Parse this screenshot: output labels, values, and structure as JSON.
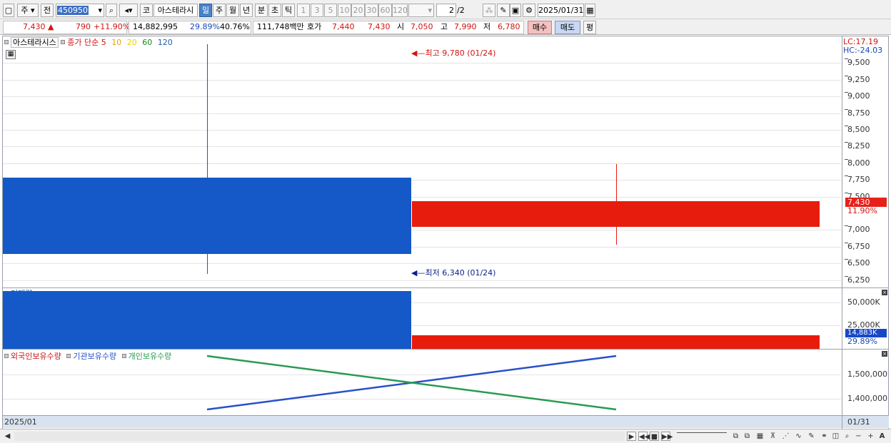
{
  "toolbar": {
    "interval_label": "주",
    "prev_label": "전",
    "code": "450950",
    "market_label": "코",
    "stock_name": "아스테라시",
    "periods": [
      "일",
      "주",
      "월",
      "년",
      "분",
      "초",
      "틱"
    ],
    "active_period": "일",
    "ticks": [
      "1",
      "3",
      "5",
      "10",
      "20",
      "30",
      "60",
      "120"
    ],
    "page_current": "2",
    "page_total": "/2",
    "date": "2025/01/31"
  },
  "quote": {
    "price": "7,430",
    "change": "790",
    "change_pct": "+11.90%",
    "volume": "14,882,995",
    "turnover": "29.89%",
    "ratio": "40.76%",
    "amount": "111,748백만",
    "hoga_label": "호가",
    "hoga_ask": "7,440",
    "hoga_bid": "7,430",
    "open_label": "시",
    "open": "7,050",
    "high_label": "고",
    "high": "7,990",
    "low_label": "저",
    "low": "6,780",
    "buy_label": "매수",
    "sell_label": "매도",
    "eval_label": "평"
  },
  "price_panel": {
    "name_tag": "아스테라시스",
    "legend_title": "종가 단순",
    "ma_labels": [
      "5",
      "10",
      "20",
      "60",
      "120"
    ],
    "ma_colors": [
      "#c81414",
      "#e8a000",
      "#e8d000",
      "#1a8a1a",
      "#1a60b0"
    ],
    "lc": "LC:17.19",
    "hc": "HC:-24.03",
    "max_label": "최고 9,780 (01/24)",
    "min_label": "최저 6,340 (01/24)",
    "current_price_tag": "7,430",
    "current_pct_tag": "11.90%"
  },
  "volume_panel": {
    "title": "거래량",
    "current_tag": "14,883K",
    "turnover_tag": "29.89%"
  },
  "holding_panel": {
    "series_labels": [
      "외국인보유수량",
      "기관보유수량",
      "개인보유수량"
    ],
    "series_colors": [
      "#c81414",
      "#2850c8",
      "#2a9a50"
    ]
  },
  "x_axis": {
    "start_label": "2025/01",
    "end_label": "01/31"
  },
  "chart_data": [
    {
      "type": "candlestick",
      "categories": [
        "01/24",
        "01/31"
      ],
      "series": [
        {
          "open": [
            7780,
            7050
          ],
          "high": [
            9780,
            7990
          ],
          "low": [
            6340,
            6780
          ],
          "close": [
            6640,
            7430
          ]
        }
      ],
      "y_ticks": [
        "9,500",
        "9,250",
        "9,000",
        "8,750",
        "8,500",
        "8,250",
        "8,000",
        "7,750",
        "7,500",
        "7,000",
        "6,750",
        "6,500",
        "6,250"
      ],
      "ylim": [
        6150,
        9900
      ],
      "grid": true
    },
    {
      "type": "bar",
      "title": "거래량",
      "categories": [
        "01/24",
        "01/31"
      ],
      "values": [
        62000,
        14883
      ],
      "colors": [
        "#1558c8",
        "#e81c0c"
      ],
      "y_ticks": [
        "50,000K",
        "25,000K"
      ],
      "ylim": [
        0,
        65000
      ]
    },
    {
      "type": "line",
      "categories": [
        "01/24",
        "01/31"
      ],
      "series": [
        {
          "name": "기관보유수량",
          "values": [
            1354000,
            1578000
          ]
        },
        {
          "name": "개인보유수량",
          "values": [
            1578000,
            1354000
          ]
        }
      ],
      "y_ticks": [
        "1,500,000",
        "1,400,000"
      ],
      "ylim": [
        1330000,
        1605000
      ]
    }
  ]
}
